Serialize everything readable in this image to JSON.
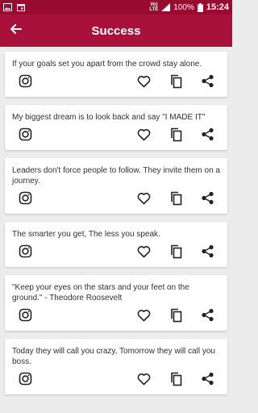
{
  "status_bar": {
    "left_icons": [
      "image-icon",
      "calendar-icon"
    ],
    "volte_top": "Vo)",
    "volte_bottom": "LTE",
    "battery_percent": "100%",
    "time": "15:24"
  },
  "app_bar": {
    "title": "Success",
    "back_icon": "arrow-back-icon"
  },
  "quotes": [
    {
      "text": "If your goals set you apart from the crowd stay alone."
    },
    {
      "text": "My biggest dream is to look back and say \"I MADE IT\""
    },
    {
      "text": "Leaders don't force people to follow. They invite them on a journey."
    },
    {
      "text": "The smarter you get, The less you speak."
    },
    {
      "text": "\"Keep your eyes on the stars and your feet on the ground.\" - Theodore Roosevelt"
    },
    {
      "text": "Today they will call you crazy, Tomorrow they will call you boss."
    }
  ],
  "card_actions": [
    "instagram-icon",
    "heart-icon",
    "copy-icon",
    "share-icon"
  ],
  "colors": {
    "status_bar": "#990b2e",
    "app_bar": "#a8113a",
    "background": "#ececec"
  }
}
